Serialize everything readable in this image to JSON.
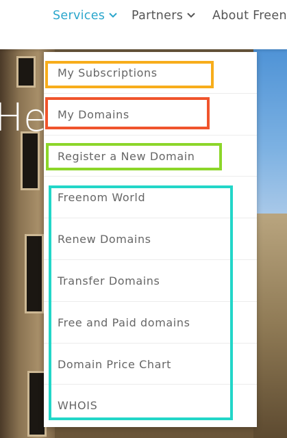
{
  "nav": {
    "items": [
      {
        "label": "Services",
        "active": true
      },
      {
        "label": "Partners",
        "active": false
      },
      {
        "label": "About Freen",
        "active": false
      }
    ],
    "active_color": "#2aa6cc"
  },
  "hero": {
    "text": "He"
  },
  "dropdown": {
    "items": [
      {
        "label": "My Subscriptions"
      },
      {
        "label": "My Domains"
      },
      {
        "label": "Register a New Domain"
      },
      {
        "label": "Freenom World"
      },
      {
        "label": "Renew Domains"
      },
      {
        "label": "Transfer Domains"
      },
      {
        "label": "Free and Paid domains"
      },
      {
        "label": "Domain Price Chart"
      },
      {
        "label": "WHOIS"
      }
    ]
  },
  "highlights": [
    {
      "color": "#f7ad1b"
    },
    {
      "color": "#f0542c"
    },
    {
      "color": "#8cd62a"
    },
    {
      "color": "#22d6c8"
    }
  ]
}
